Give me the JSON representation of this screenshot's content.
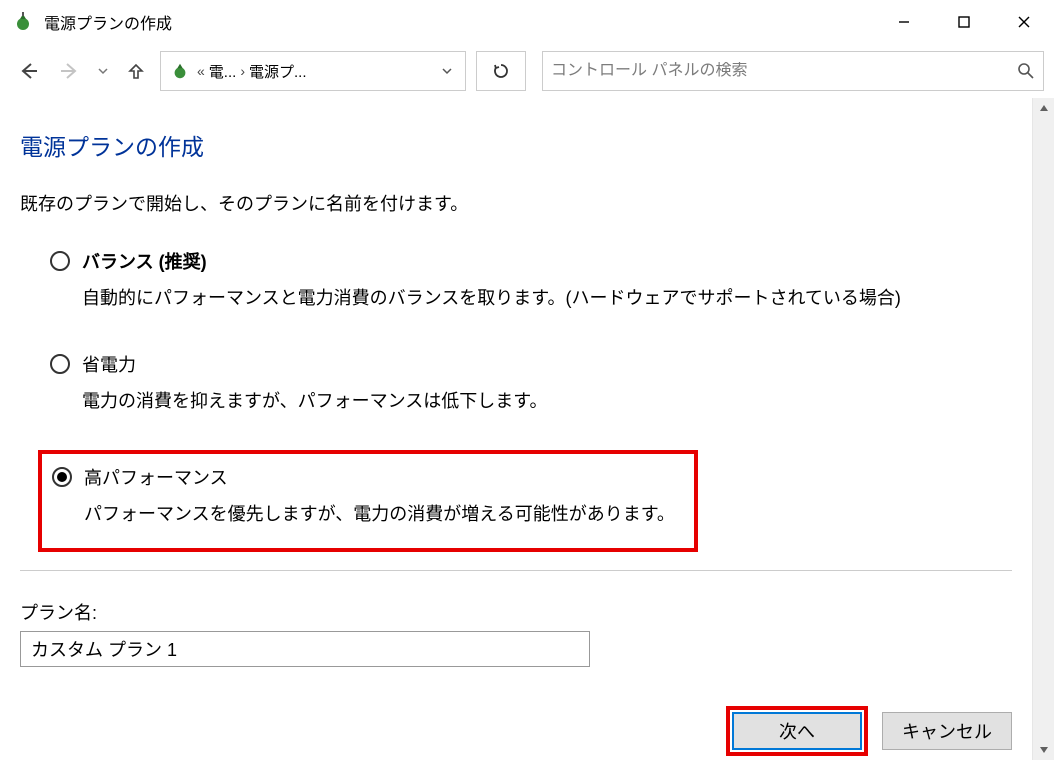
{
  "window": {
    "title": "電源プランの作成"
  },
  "nav": {
    "breadcrumb_seg1": "電...",
    "breadcrumb_seg2": "電源プ...",
    "search_placeholder": "コントロール パネルの検索"
  },
  "page": {
    "title": "電源プランの作成",
    "subtitle": "既存のプランで開始し、そのプランに名前を付けます。"
  },
  "options": [
    {
      "label": "バランス (推奨)",
      "desc": "自動的にパフォーマンスと電力消費のバランスを取ります。(ハードウェアでサポートされている場合)",
      "checked": false,
      "bold": true
    },
    {
      "label": "省電力",
      "desc": "電力の消費を抑えますが、パフォーマンスは低下します。",
      "checked": false,
      "bold": false
    },
    {
      "label": "高パフォーマンス",
      "desc": "パフォーマンスを優先しますが、電力の消費が増える可能性があります。",
      "checked": true,
      "bold": false
    }
  ],
  "plan": {
    "label": "プラン名:",
    "value": "カスタム プラン 1"
  },
  "footer": {
    "next": "次へ",
    "cancel": "キャンセル"
  }
}
